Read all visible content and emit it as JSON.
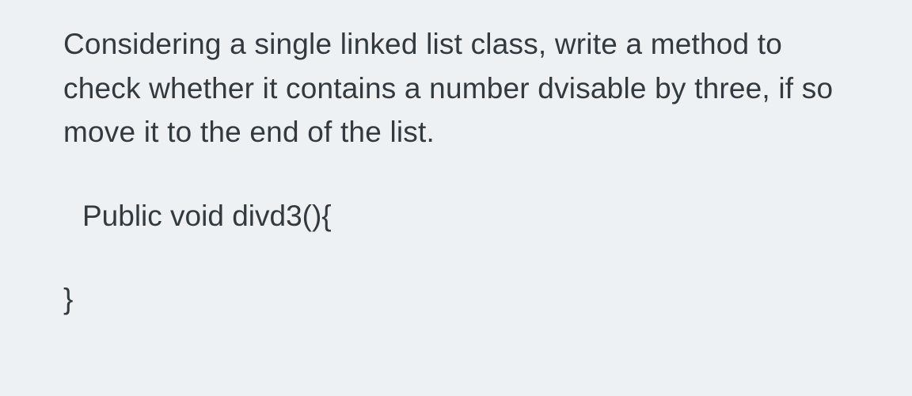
{
  "question": {
    "prompt": "Considering a single linked list class, write a method to check whether it contains a number dvisable by three, if so move it to the end of the list.",
    "code_signature": "Public void divd3(){",
    "code_close": "}"
  }
}
